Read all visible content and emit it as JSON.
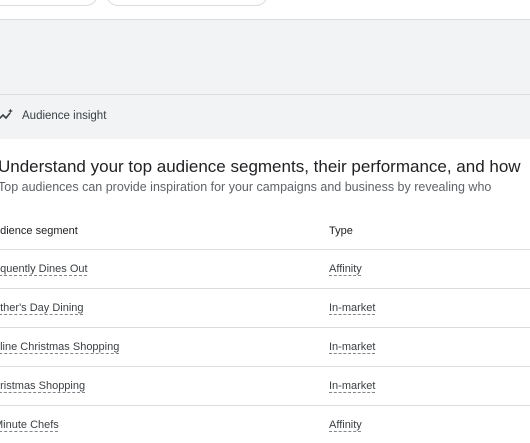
{
  "insight": {
    "label": "Audience insight",
    "icon": "sparkle-trend-icon"
  },
  "section": {
    "headline": "Understand your top audience segments, their performance, and how",
    "subline": "Top audiences can provide inspiration for your campaigns and business by revealing who"
  },
  "table": {
    "headers": {
      "segment": "udience segment",
      "type": "Type"
    },
    "rows": [
      {
        "segment": "equently Dines Out",
        "type": "Affinity"
      },
      {
        "segment": "other's Day Dining",
        "type": "In-market"
      },
      {
        "segment": "nline Christmas Shopping",
        "type": "In-market"
      },
      {
        "segment": "hristmas Shopping",
        "type": "In-market"
      },
      {
        "segment": "Minute Chefs",
        "type": "Affinity"
      }
    ]
  }
}
